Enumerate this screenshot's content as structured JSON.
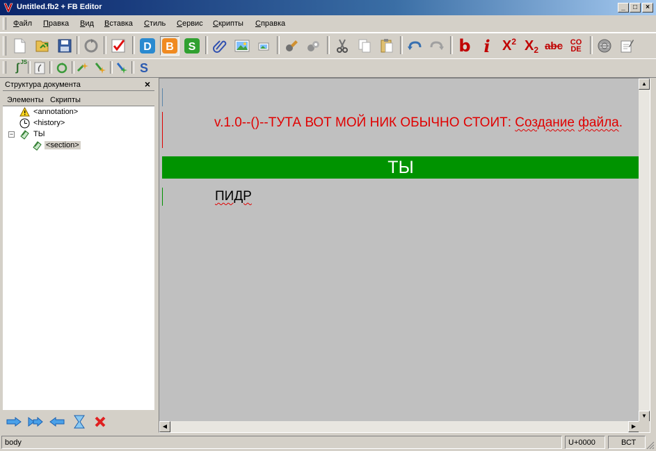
{
  "window": {
    "title": "Untitled.fb2 + FB Editor",
    "minimize": "_",
    "maximize": "□",
    "close": "×"
  },
  "menu": [
    {
      "label": "Файл",
      "u": "Ф",
      "rest": "айл"
    },
    {
      "label": "Правка",
      "u": "П",
      "rest": "равка"
    },
    {
      "label": "Вид",
      "u": "В",
      "rest": "ид"
    },
    {
      "label": "Вставка",
      "u": "В",
      "rest": "ставка"
    },
    {
      "label": "Стиль",
      "u": "С",
      "rest": "тиль"
    },
    {
      "label": "Сервис",
      "u": "С",
      "rest": "ервис"
    },
    {
      "label": "Скрипты",
      "u": "С",
      "rest": "крипты"
    },
    {
      "label": "Справка",
      "u": "С",
      "rest": "правка"
    }
  ],
  "toolbar": {
    "desc_label": "D",
    "body_label": "B",
    "source_label": "S",
    "bold_label": "b",
    "italic_label": "i",
    "sup_label": "X",
    "sup_small": "2",
    "sub_label": "X",
    "sub_small": "2",
    "strike_label": "abc",
    "code_top": "CO",
    "code_bottom": "DE",
    "js_label": "JS",
    "script_label": "S"
  },
  "left_panel": {
    "title": "Структура документа",
    "close": "×",
    "tabs": [
      "Элементы",
      "Скрипты"
    ],
    "tree": {
      "annotation": "<annotation>",
      "history": "<history>",
      "body_node": "ТЫ",
      "section": "<section>"
    }
  },
  "document": {
    "para1_version": "v.1.0--()--ТУТА ВОТ МОЙ НИК ОБЫЧНО СТОИТ:",
    "para1_word1": "Создание",
    "para1_word2": "файла",
    "para1_end": ".",
    "title": "ТЫ",
    "para2": "ПИДР"
  },
  "statusbar": {
    "mode": "body",
    "unicode": "U+0000",
    "insert": "ВСТ"
  },
  "colors": {
    "title_bg": "#009300",
    "red_text": "#e00000"
  }
}
